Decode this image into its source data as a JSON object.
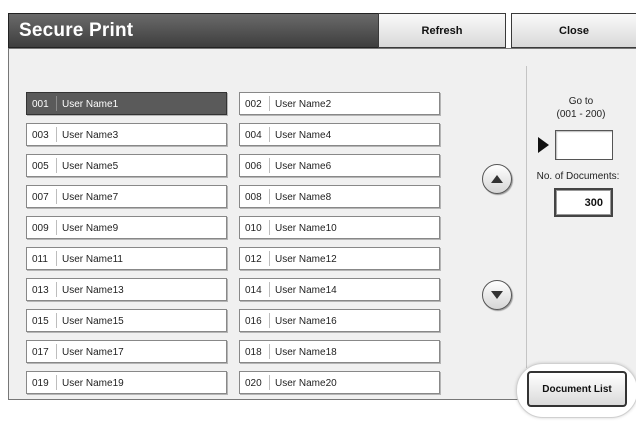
{
  "header": {
    "title": "Secure Print",
    "refresh_label": "Refresh",
    "close_label": "Close"
  },
  "entries": [
    {
      "num": "001",
      "name": "User Name1",
      "selected": true
    },
    {
      "num": "002",
      "name": "User Name2"
    },
    {
      "num": "003",
      "name": "User Name3"
    },
    {
      "num": "004",
      "name": "User Name4"
    },
    {
      "num": "005",
      "name": "User Name5"
    },
    {
      "num": "006",
      "name": "User Name6"
    },
    {
      "num": "007",
      "name": "User Name7"
    },
    {
      "num": "008",
      "name": "User Name8"
    },
    {
      "num": "009",
      "name": "User Name9"
    },
    {
      "num": "010",
      "name": "User Name10"
    },
    {
      "num": "011",
      "name": "User Name11"
    },
    {
      "num": "012",
      "name": "User Name12"
    },
    {
      "num": "013",
      "name": "User Name13"
    },
    {
      "num": "014",
      "name": "User Name14"
    },
    {
      "num": "015",
      "name": "User Name15"
    },
    {
      "num": "016",
      "name": "User Name16"
    },
    {
      "num": "017",
      "name": "User Name17"
    },
    {
      "num": "018",
      "name": "User Name18"
    },
    {
      "num": "019",
      "name": "User Name19"
    },
    {
      "num": "020",
      "name": "User Name20"
    }
  ],
  "scroll": {
    "up_icon": "scroll-up-arrow-icon",
    "down_icon": "scroll-down-arrow-icon"
  },
  "side": {
    "goto_label": "Go to",
    "goto_range": "(001 - 200)",
    "goto_value": "",
    "docs_label": "No. of Documents:",
    "docs_count": "300"
  },
  "document_list_label": "Document List",
  "colors": {
    "header_bg": "#4a4a4a",
    "selected_row": "#5a5a5a",
    "panel_bg": "#f0f0f0"
  }
}
